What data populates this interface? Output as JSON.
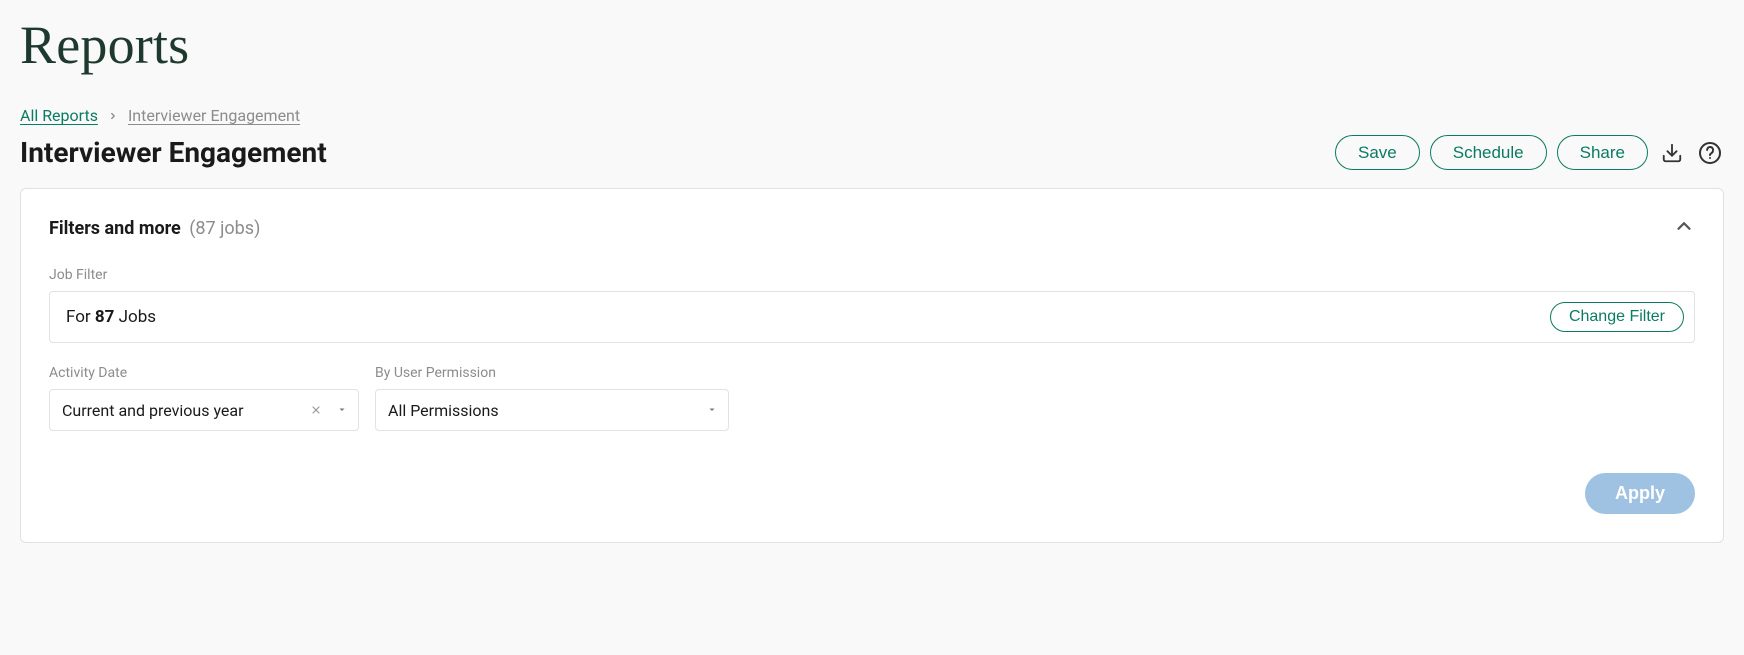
{
  "page": {
    "title": "Reports"
  },
  "breadcrumb": {
    "root": "All Reports",
    "current": "Interviewer Engagement"
  },
  "report": {
    "title": "Interviewer Engagement"
  },
  "actions": {
    "save": "Save",
    "schedule": "Schedule",
    "share": "Share"
  },
  "filters_panel": {
    "title": "Filters and more",
    "subtitle": "(87 jobs)"
  },
  "job_filter": {
    "label": "Job Filter",
    "prefix": "For ",
    "count": "87",
    "suffix": " Jobs",
    "change_label": "Change Filter"
  },
  "activity_date": {
    "label": "Activity Date",
    "value": "Current and previous year"
  },
  "permission": {
    "label": "By User Permission",
    "value": "All Permissions"
  },
  "apply": {
    "label": "Apply"
  }
}
